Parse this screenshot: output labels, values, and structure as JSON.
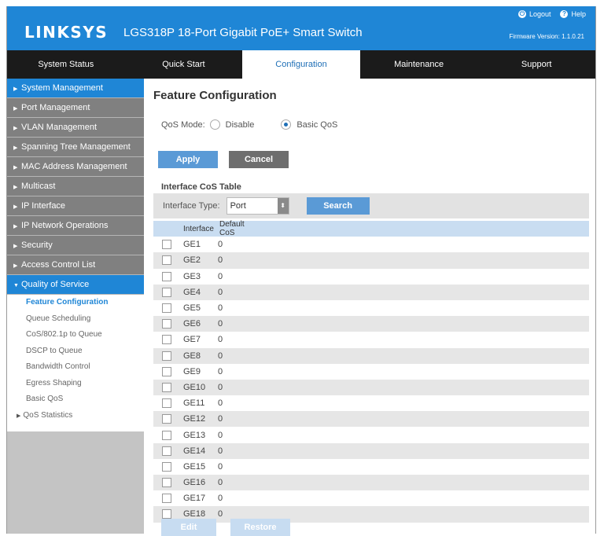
{
  "header": {
    "logo": "LINKSYS",
    "product": "LGS318P 18-Port Gigabit PoE+ Smart Switch",
    "logout_label": "Logout",
    "help_label": "Help",
    "firmware": "Firmware Version: 1.1.0.21",
    "bg_color": "#1f86d6"
  },
  "topnav": {
    "tabs": [
      "System Status",
      "Quick Start",
      "Configuration",
      "Maintenance",
      "Support"
    ],
    "active": "Configuration"
  },
  "sidebar": {
    "items": [
      "System Management",
      "Port Management",
      "VLAN Management",
      "Spanning Tree Management",
      "MAC Address Management",
      "Multicast",
      "IP Interface",
      "IP Network Operations",
      "Security",
      "Access Control List",
      "Quality of Service"
    ],
    "subitems": [
      "Feature Configuration",
      "Queue Scheduling",
      "CoS/802.1p to Queue",
      "DSCP to Queue",
      "Bandwidth Control",
      "Egress Shaping",
      "Basic QoS",
      "QoS Statistics"
    ]
  },
  "main": {
    "title": "Feature Configuration",
    "qos_mode_label": "QoS Mode:",
    "option_disable": "Disable",
    "option_basic": "Basic QoS",
    "selected_mode": "Basic QoS",
    "apply": "Apply",
    "cancel": "Cancel",
    "table_title": "Interface CoS Table",
    "interface_type_label": "Interface Type:",
    "interface_type_value": "Port",
    "search": "Search",
    "columns": [
      "Interface",
      "Default CoS"
    ],
    "rows": [
      [
        "GE1",
        "0"
      ],
      [
        "GE2",
        "0"
      ],
      [
        "GE3",
        "0"
      ],
      [
        "GE4",
        "0"
      ],
      [
        "GE5",
        "0"
      ],
      [
        "GE6",
        "0"
      ],
      [
        "GE7",
        "0"
      ],
      [
        "GE8",
        "0"
      ],
      [
        "GE9",
        "0"
      ],
      [
        "GE10",
        "0"
      ],
      [
        "GE11",
        "0"
      ],
      [
        "GE12",
        "0"
      ],
      [
        "GE13",
        "0"
      ],
      [
        "GE14",
        "0"
      ],
      [
        "GE15",
        "0"
      ],
      [
        "GE16",
        "0"
      ],
      [
        "GE17",
        "0"
      ],
      [
        "GE18",
        "0"
      ]
    ],
    "edit": "Edit",
    "restore": "Restore"
  }
}
